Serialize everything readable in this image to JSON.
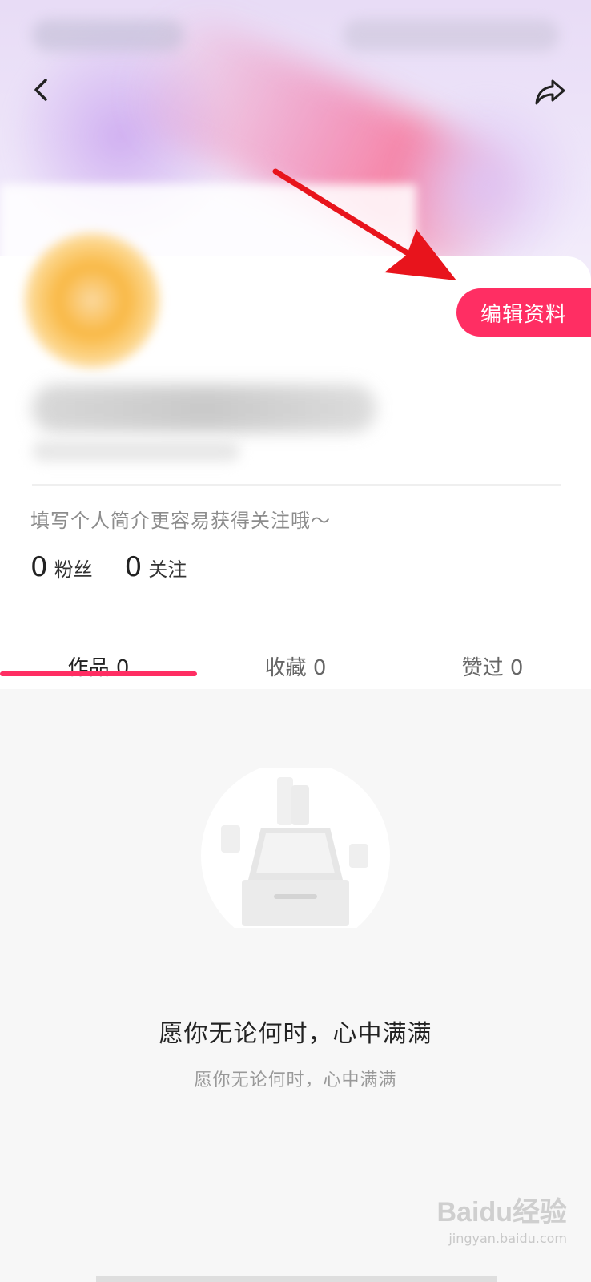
{
  "header": {
    "back_icon": "chevron-left-icon",
    "share_icon": "share-forward-icon"
  },
  "profile": {
    "edit_button_label": "编辑资料",
    "bio_placeholder": "填写个人简介更容易获得关注哦～",
    "stats": [
      {
        "value": "0",
        "label": "粉丝"
      },
      {
        "value": "0",
        "label": "关注"
      }
    ]
  },
  "tabs": [
    {
      "label": "作品 0",
      "active": true
    },
    {
      "label": "收藏 0",
      "active": false
    },
    {
      "label": "赞过 0",
      "active": false
    }
  ],
  "empty_state": {
    "title": "愿你无论何时，心中满满",
    "subtitle": "愿你无论何时，心中满满"
  },
  "watermark": {
    "main": "Baidu经验",
    "sub": "jingyan.baidu.com"
  },
  "colors": {
    "accent": "#ff2e63",
    "annotation_arrow": "#e8141c"
  }
}
